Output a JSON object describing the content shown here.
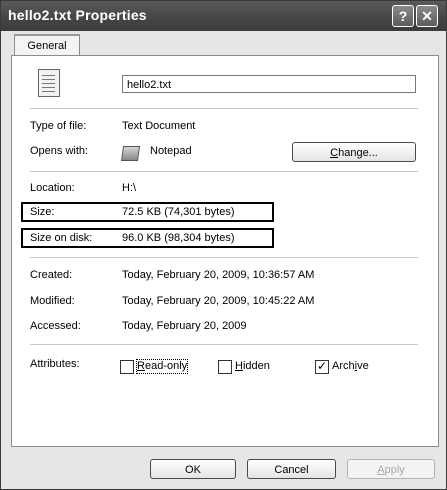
{
  "window": {
    "title": "hello2.txt Properties",
    "help_glyph": "?",
    "close_glyph": "✕"
  },
  "tabs": [
    {
      "label": "General",
      "selected": true
    }
  ],
  "file": {
    "name": "hello2.txt",
    "icon": "text-file-icon"
  },
  "details": {
    "type_label": "Type of file:",
    "type_value": "Text Document",
    "opens_label": "Opens with:",
    "opens_value": "Notepad",
    "opens_icon": "notepad-icon",
    "change_button": {
      "prefix": "",
      "hotkey": "C",
      "rest": "hange..."
    },
    "location_label": "Location:",
    "location_value": "H:\\",
    "size_label": "Size:",
    "size_value": "72.5 KB (74,301 bytes)",
    "size_on_disk_label": "Size on disk:",
    "size_on_disk_value": "96.0 KB (98,304 bytes)",
    "created_label": "Created:",
    "created_value": "Today, February 20, 2009, 10:36:57 AM",
    "modified_label": "Modified:",
    "modified_value": "Today, February 20, 2009, 10:45:22 AM",
    "accessed_label": "Accessed:",
    "accessed_value": "Today, February 20, 2009"
  },
  "attributes": {
    "label": "Attributes:",
    "read_only": {
      "hotkey": "R",
      "rest": "ead-only",
      "checked": false
    },
    "hidden": {
      "hotkey": "H",
      "rest": "idden",
      "checked": false
    },
    "archive": {
      "pre": "Arch",
      "hotkey": "i",
      "rest": "ve",
      "checked": true,
      "mark": "✓"
    }
  },
  "buttons": {
    "ok": "OK",
    "cancel": "Cancel",
    "apply": {
      "hotkey": "A",
      "rest": "pply",
      "enabled": false
    }
  },
  "colors": {
    "highlight_border": "#000000",
    "titlebar": "#4a4a4a"
  }
}
